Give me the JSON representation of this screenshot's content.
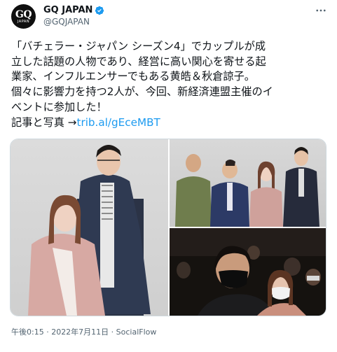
{
  "account": {
    "display_name": "GQ JAPAN",
    "handle": "@GQJAPAN",
    "avatar_logo": "GQ",
    "avatar_sub": "JAPAN"
  },
  "tweet": {
    "lines": [
      "「バチェラー・ジャパン シーズン4」でカップルが成",
      "立した話題の人物であり、経営に高い関心を寄せる起",
      "業家、インフルエンサーでもある黄皓＆秋倉諒子。",
      "個々に影響力を持つ2人が、今回、新経済連盟主催のイ",
      "ベントに参加した！"
    ],
    "link_prefix": "記事と写真 →",
    "link_text": "trib.al/gEceMBT"
  },
  "footer": {
    "meta": "午後0:15 · 2022年7月11日 · SocialFlow"
  },
  "colors": {
    "link": "#1d9bf0",
    "verified": "#1d9bf0",
    "secondary_text": "#536471"
  },
  "icons": {
    "verified": "verified-badge-icon",
    "more": "more-options-icon"
  }
}
